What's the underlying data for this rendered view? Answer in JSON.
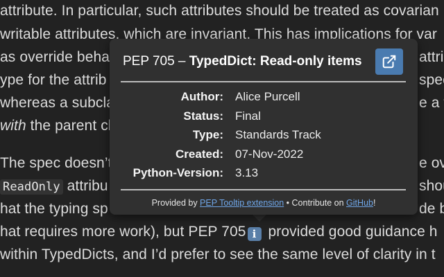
{
  "background_text": {
    "line1": "attribute. In particular, such attributes should be treated as covarian",
    "line2": "writable attributes, which are invariant. This has implications for var",
    "line3_a": "as override behav",
    "line3_b": "attrib",
    "line4_a": "ype for the attrib",
    "line4_b": "specif",
    "line5_a": "whereas a subcla",
    "line5_b": "e a typ",
    "line6_em": "with",
    "line6_rest": " the parent cl",
    "line7_a": "The spec doesn’t",
    "line7_b": "e over",
    "line8_code": "ReadOnly",
    "line8_a": " attribu",
    "line8_b": "shoul",
    "line9_a": "hat the typing sp",
    "line9_b": "de be",
    "line10_a": "hat requires more work), but PEP 705",
    "line10_b": " provided good guidance h",
    "line11": "within TypedDicts, and I’d prefer to see the same level of clarity in t"
  },
  "tooltip": {
    "title_prefix": "PEP 705 – ",
    "title_bold": "TypedDict: Read-only items",
    "open_icon": "external-link-icon",
    "fields": [
      {
        "key": "Author:",
        "value": "Alice Purcell"
      },
      {
        "key": "Status:",
        "value": "Final"
      },
      {
        "key": "Type:",
        "value": "Standards Track"
      },
      {
        "key": "Created:",
        "value": "07-Nov-2022"
      },
      {
        "key": "Python-Version:",
        "value": "3.13"
      }
    ],
    "footer": {
      "provided_by": "Provided by ",
      "extension_link": "PEP Tooltip extension",
      "separator": " • Contribute on ",
      "github_link": "GitHub",
      "end": "!"
    }
  },
  "colors": {
    "background": "#222222",
    "tooltip_bg": "#303030",
    "button_bg": "#4a7bb0",
    "link": "#6fa6e8"
  }
}
